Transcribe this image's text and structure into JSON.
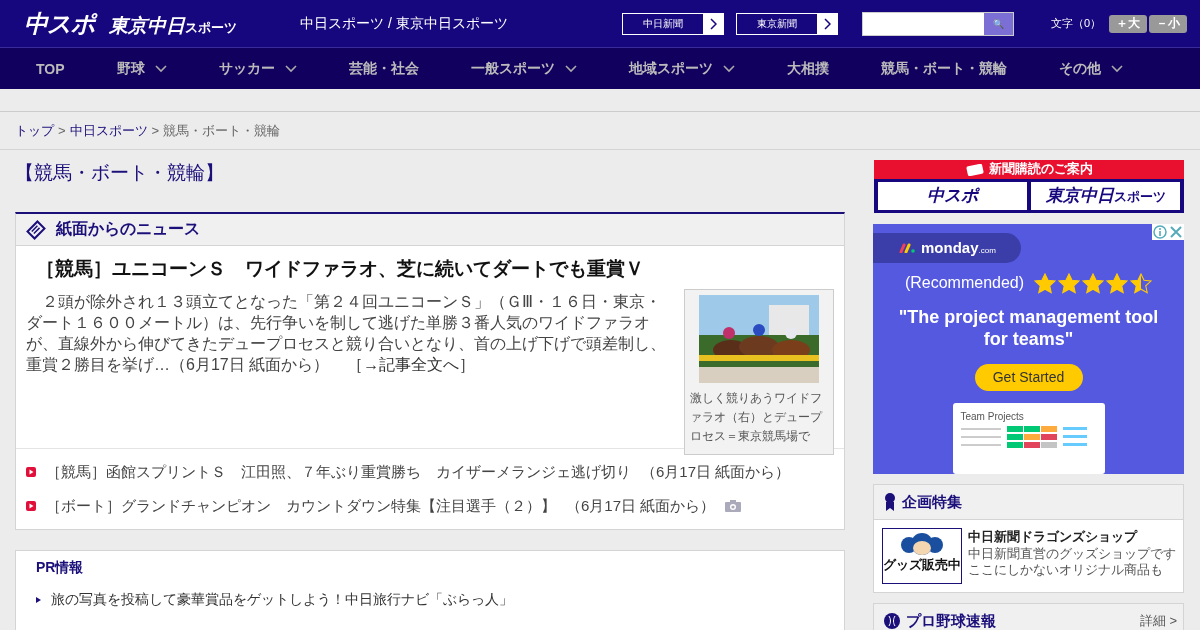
{
  "header": {
    "logo_main": "中スポ",
    "logo_sub": "東京中日",
    "logo_sub_small": "スポーツ",
    "site_links": "中日スポーツ / 東京中日スポーツ",
    "paper_links": [
      "中日新聞",
      "東京新聞"
    ],
    "search": {
      "button": "🔍"
    },
    "font_size_label": "文字（0）",
    "font_buttons": [
      "＋大",
      "－小"
    ]
  },
  "nav": [
    {
      "label": "TOP",
      "dropdown": false
    },
    {
      "label": "野球",
      "dropdown": true
    },
    {
      "label": "サッカー",
      "dropdown": true
    },
    {
      "label": "芸能・社会",
      "dropdown": false
    },
    {
      "label": "一般スポーツ",
      "dropdown": true
    },
    {
      "label": "地域スポーツ",
      "dropdown": true
    },
    {
      "label": "大相撲",
      "dropdown": false
    },
    {
      "label": "競馬・ボート・競輪",
      "dropdown": false
    },
    {
      "label": "その他",
      "dropdown": true
    }
  ],
  "breadcrumb": [
    {
      "label": "トップ",
      "link": true
    },
    {
      "label": "中日スポーツ",
      "link": true
    },
    {
      "label": "競馬・ボート・競輪",
      "link": false
    }
  ],
  "breadcrumb_separator": ">",
  "page_title": "【競馬・ボート・競輪】",
  "news_section": {
    "title": "紙面からのニュース",
    "lead": {
      "headline": "［競馬］ユニコーンＳ　ワイドファラオ、芝に続いてダートでも重賞Ｖ",
      "body": "　２頭が除外され１３頭立てとなった「第２４回ユニコーンＳ」（ＧⅢ・１６日・東京・ダート１６００メートル）は、先行争いを制して逃げた単勝３番人気のワイドファラオが、直線外から伸びてきたデュープロセスと競り合いとなり、首の上げ下げで頭差制し、重賞２勝目を挙げ…（6月17日 紙面から）",
      "more": "［→記事全文へ］",
      "photo": {
        "kind": "picture",
        "caption": "激しく競りあうワイドファラオ（右）とデュープロセス＝東京競馬場で"
      }
    },
    "items": [
      {
        "text": "［競馬］函館スプリントＳ　江田照、７年ぶり重賞勝ち　カイザーメランジェ逃げ切り",
        "date": "（6月17日 紙面から）",
        "has_photo": false
      },
      {
        "text": "［ボート］グランドチャンピオン　カウントダウン特集【注目選手（２）】",
        "date": "（6月17日 紙面から）",
        "has_photo": true
      }
    ]
  },
  "pr": {
    "title": "PR情報",
    "items": [
      "旅の写真を投稿して豪華賞品をゲットしよう！中日旅行ナビ「ぶらっ人」"
    ]
  },
  "sidebar": {
    "subscribe": {
      "title": "新聞購読のご案内",
      "logos": [
        "中スポ",
        "東京中日"
      ],
      "logo_small": "スポーツ"
    },
    "ad": {
      "brand": "monday",
      "brand_suffix": ".com",
      "tagline": "(Recommended)",
      "stars": 4.5,
      "headline": "\"The project management tool for teams\"",
      "button": "Get Started",
      "screenshot_title": "Team Projects"
    },
    "feature": {
      "title": "企画特集",
      "item": {
        "title": "中日新聞ドラゴンズショップ",
        "lines": [
          "中日新聞直営のグッズショップです",
          "ここにしかないオリジナル商品も"
        ],
        "thumb_label": "グッズ販売中"
      }
    },
    "scores": {
      "title": "プロ野球速報",
      "more": "詳細 >"
    }
  }
}
